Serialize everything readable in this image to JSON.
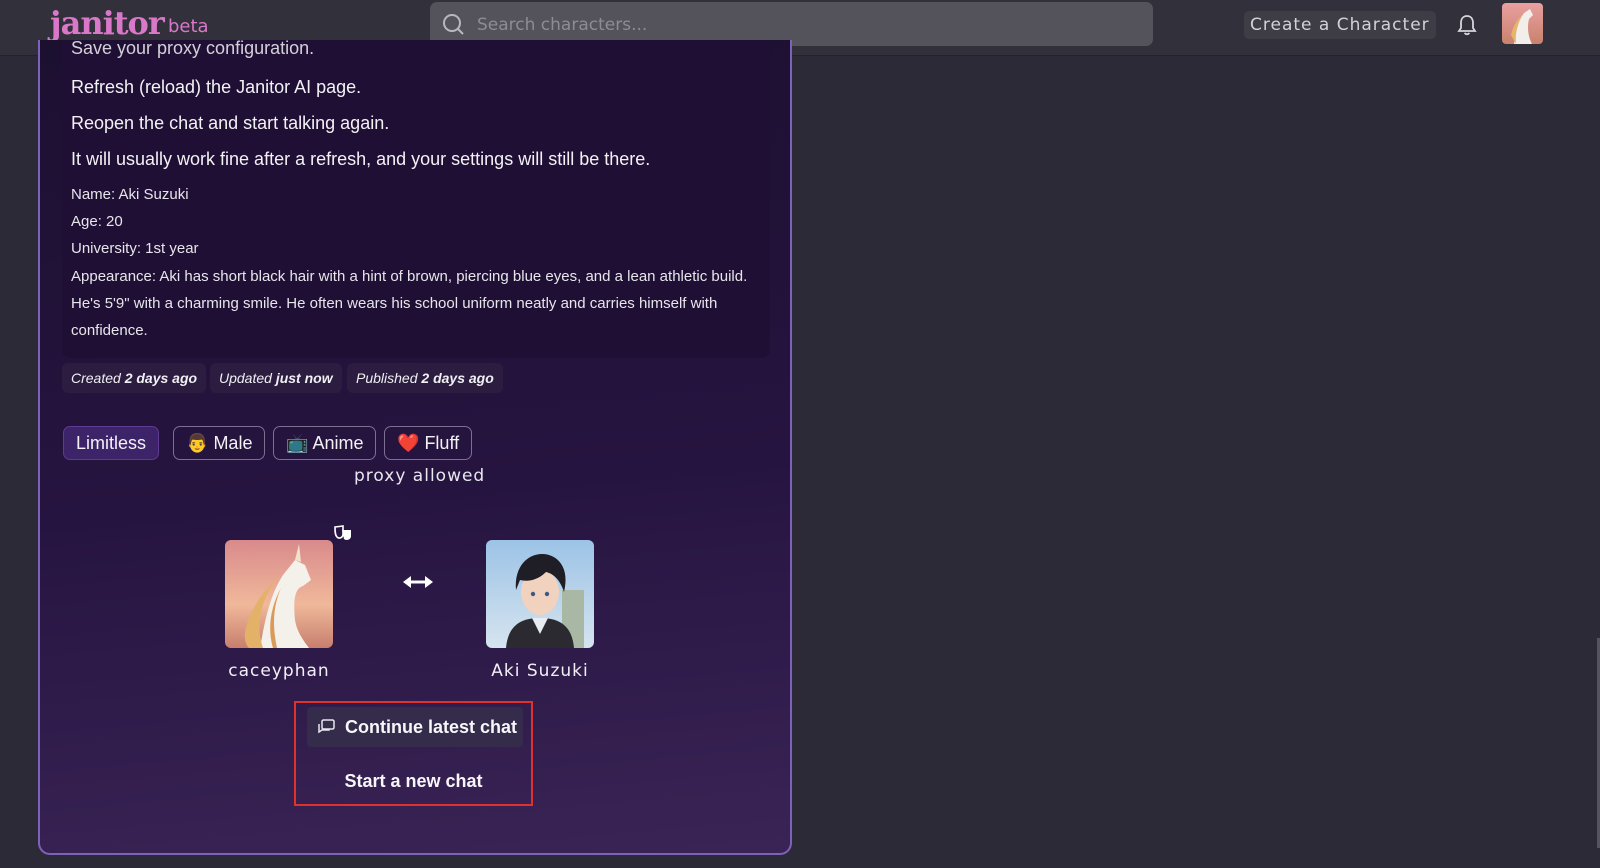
{
  "header": {
    "logo_text": "janitor",
    "beta_label": "beta",
    "search_placeholder": "Search characters...",
    "create_label": "Create a Character"
  },
  "description": {
    "partial_line": "Save your proxy configuration.",
    "steps": [
      "Refresh (reload) the Janitor AI page.",
      "Reopen the chat and start talking again.",
      "It will usually work fine after a refresh, and your settings will still be there."
    ],
    "name": "Name: Aki Suzuki",
    "age": "Age: 20",
    "university": "University: 1st year",
    "appearance": "Appearance: Aki has short black hair with a hint of brown, piercing blue eyes, and a lean athletic build. He's 5'9\" with a charming smile. He often wears his school uniform neatly and carries himself with confidence."
  },
  "meta": {
    "created_prefix": "Created",
    "created_value": "2 days ago",
    "updated_prefix": "Updated",
    "updated_value": "just now",
    "published_prefix": "Published",
    "published_value": "2 days ago"
  },
  "tags": [
    {
      "label": "Limitless",
      "emoji": ""
    },
    {
      "label": "Male",
      "emoji": "👨"
    },
    {
      "label": "Anime",
      "emoji": "📺"
    },
    {
      "label": "Fluff",
      "emoji": "❤️"
    }
  ],
  "proxy_label": "proxy allowed",
  "persona": {
    "name": "caceyphan"
  },
  "character": {
    "name": "Aki Suzuki"
  },
  "actions": {
    "continue_label": "Continue latest chat",
    "new_chat_label": "Start a new chat"
  },
  "colors": {
    "brand": "#d978c9",
    "highlight_box": "#e0322d",
    "card_border": "#7d62bc"
  }
}
